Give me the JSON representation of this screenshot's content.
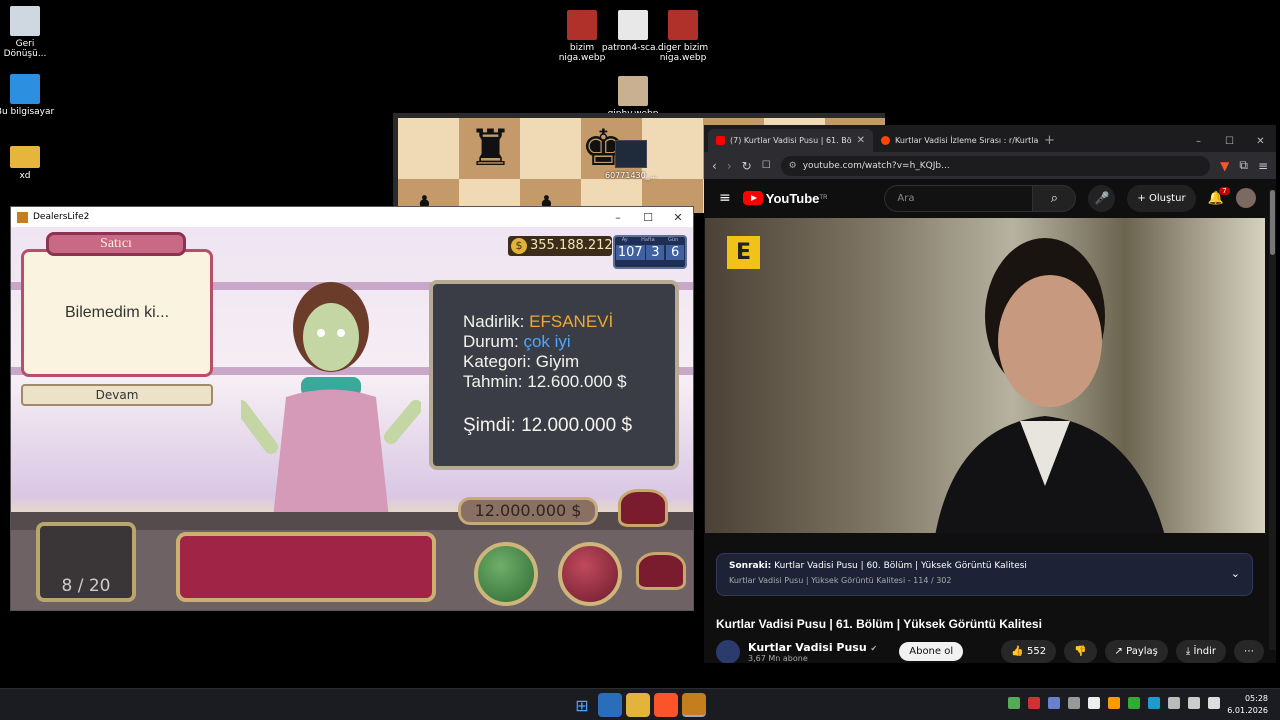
{
  "desktop": {
    "icons": [
      {
        "label": "Geri Dönüşü..."
      },
      {
        "label": "Bu bilgisayar"
      },
      {
        "label": "xd"
      },
      {
        "label": "bizim niga.webp"
      },
      {
        "label": "patron4-sca..."
      },
      {
        "label": "diger bizim niga.webp"
      },
      {
        "label": "giphy.webp"
      },
      {
        "label": "60771430_..."
      }
    ]
  },
  "game": {
    "window_title": "DealersLife2",
    "speaker_tag": "Satıcı",
    "dialog": "Bilemedim ki...",
    "continue_label": "Devam",
    "money": "355.188.212",
    "date": {
      "headers": [
        "Ay",
        "Hafta",
        "Gün"
      ],
      "values": [
        "107",
        "3",
        "6"
      ]
    },
    "info": {
      "rarity_label": "Nadirlik:",
      "rarity_value": "EFSANEVİ",
      "condition_label": "Durum:",
      "condition_value": "çok iyi",
      "category_label": "Kategori:",
      "category_value": "Giyim",
      "estimate_label": "Tahmin:",
      "estimate_value": "12.600.000 $",
      "now_label": "Şimdi:",
      "now_value": "12.000.000 $"
    },
    "offer": "12.000.000 $",
    "inventory": "8 / 20",
    "colors": {
      "rarity": "#f0a830",
      "condition": "#4aa6ff"
    }
  },
  "browser": {
    "tabs": [
      {
        "label": "(7) Kurtlar Vadisi Pusu | 61. Bö"
      },
      {
        "label": "Kurtlar Vadisi İzleme Sırası : r/Kurtlar"
      }
    ],
    "url": "youtube.com/watch?v=h_KQJb...",
    "youtube": {
      "logo": "YouTube",
      "region": "TR",
      "search_placeholder": "Ara",
      "create_label": "Oluştur",
      "notif_count": "7",
      "upnext_prefix": "Sonraki:",
      "upnext_title": "Kurtlar Vadisi Pusu | 60. Bölüm | Yüksek Görüntü Kalitesi",
      "upnext_sub": "Kurtlar Vadisi Pusu | Yüksek Görüntü Kalitesi - 114 / 302",
      "video_title": "Kurtlar Vadisi Pusu | 61. Bölüm | Yüksek Görüntü Kalitesi",
      "channel_name": "Kurtlar Vadisi Pusu",
      "channel_subs": "3,67 Mn abone",
      "subscribe_label": "Abone ol",
      "likes": "552",
      "share_label": "Paylaş",
      "download_label": "İndir"
    }
  },
  "taskbar": {
    "time": "05:28",
    "date": "6.01.2026"
  }
}
